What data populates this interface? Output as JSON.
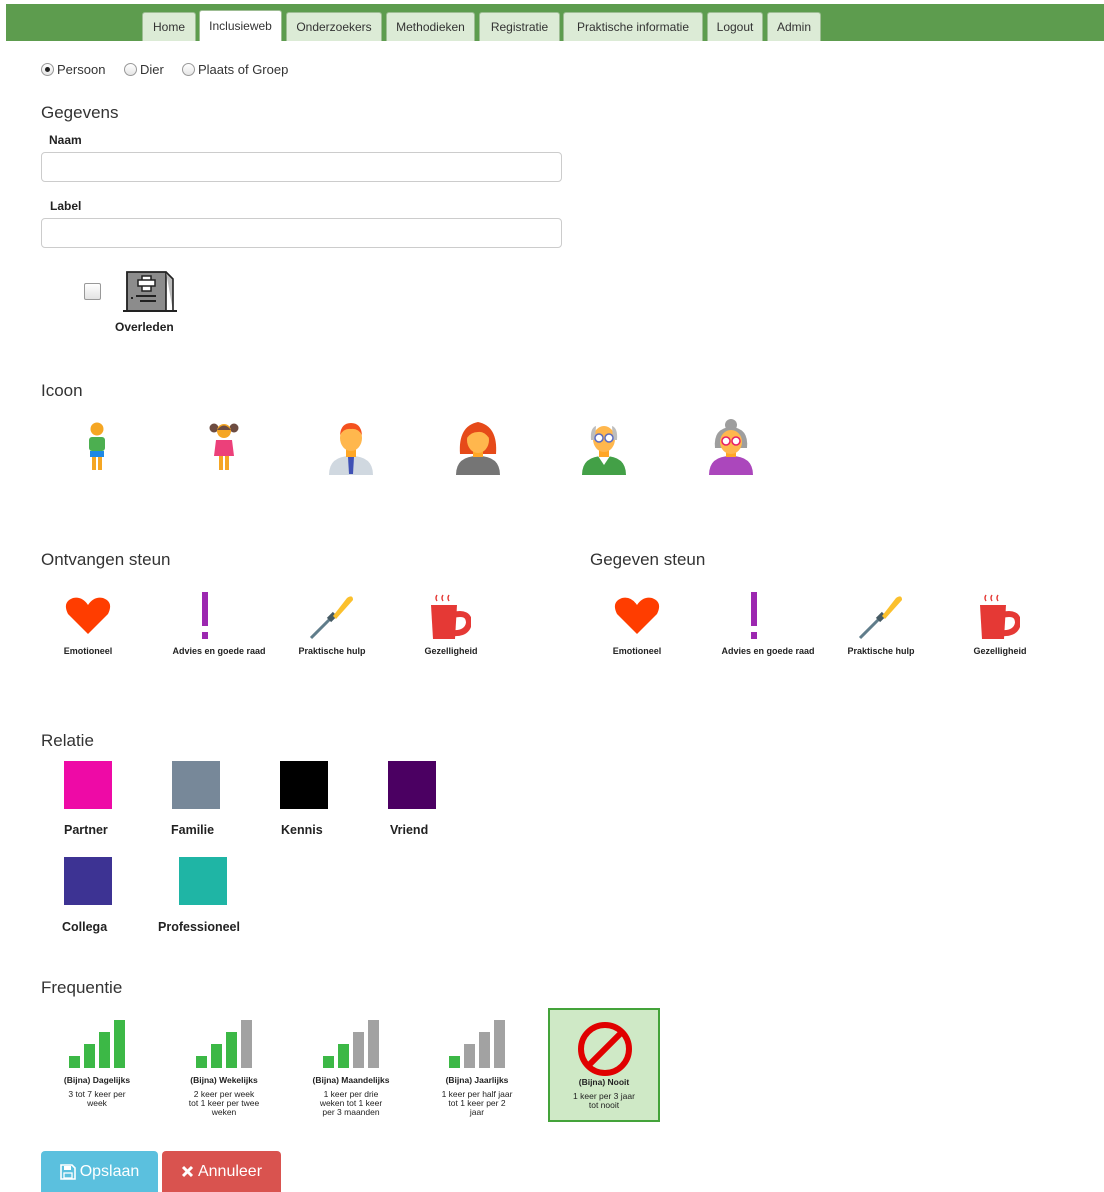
{
  "nav": {
    "tabs": [
      {
        "label": "Home",
        "active": false
      },
      {
        "label": "Inclusieweb",
        "active": true
      },
      {
        "label": "Onderzoekers",
        "active": false
      },
      {
        "label": "Methodieken",
        "active": false
      },
      {
        "label": "Registratie",
        "active": false
      },
      {
        "label": "Praktische informatie",
        "active": false
      },
      {
        "label": "Logout",
        "active": false
      },
      {
        "label": "Admin",
        "active": false
      }
    ]
  },
  "type_options": [
    {
      "label": "Persoon",
      "checked": true
    },
    {
      "label": "Dier",
      "checked": false
    },
    {
      "label": "Plaats of Groep",
      "checked": false
    }
  ],
  "gegevens": {
    "title": "Gegevens",
    "naam_label": "Naam",
    "naam_value": "",
    "label_label": "Label",
    "label_value": "",
    "overleden_label": "Overleden",
    "overleden_checked": false,
    "overleden_icon": "tombstone-icon"
  },
  "icoon": {
    "title": "Icoon",
    "icons": [
      "boy-icon",
      "girl-icon",
      "man-icon",
      "woman-icon",
      "old-man-icon",
      "old-woman-icon"
    ]
  },
  "ontvangen": {
    "title": "Ontvangen steun",
    "items": [
      {
        "label": "Emotioneel",
        "icon": "heart-icon"
      },
      {
        "label": "Advies en goede raad",
        "icon": "exclamation-icon"
      },
      {
        "label": "Praktische hulp",
        "icon": "screwdriver-icon"
      },
      {
        "label": "Gezelligheid",
        "icon": "mug-icon"
      }
    ]
  },
  "gegeven": {
    "title": "Gegeven steun",
    "items": [
      {
        "label": "Emotioneel",
        "icon": "heart-icon"
      },
      {
        "label": "Advies en goede raad",
        "icon": "exclamation-icon"
      },
      {
        "label": "Praktische hulp",
        "icon": "screwdriver-icon"
      },
      {
        "label": "Gezelligheid",
        "icon": "mug-icon"
      }
    ]
  },
  "relatie": {
    "title": "Relatie",
    "items": [
      {
        "label": "Partner",
        "color": "#ee0aa6"
      },
      {
        "label": "Familie",
        "color": "#778899"
      },
      {
        "label": "Kennis",
        "color": "#000000"
      },
      {
        "label": "Vriend",
        "color": "#4b0062"
      },
      {
        "label": "Collega",
        "color": "#3d3393"
      },
      {
        "label": "Professioneel",
        "color": "#1fb5a5"
      }
    ]
  },
  "frequentie": {
    "title": "Frequentie",
    "items": [
      {
        "title": "(Bijna) Dagelijks",
        "desc": "3 tot 7 keer per week",
        "green_bars": 4,
        "selected": false
      },
      {
        "title": "(Bijna) Wekelijks",
        "desc": "2 keer per week tot 1 keer per twee weken",
        "green_bars": 3,
        "selected": false
      },
      {
        "title": "(Bijna) Maandelijks",
        "desc": "1 keer per drie weken tot 1 keer per 3 maanden",
        "green_bars": 2,
        "selected": false
      },
      {
        "title": "(Bijna) Jaarlijks",
        "desc": "1 keer per half jaar tot 1 keer per 2 jaar",
        "green_bars": 1,
        "selected": false
      },
      {
        "title": "(Bijna) Nooit",
        "desc": "1 keer per 3 jaar tot nooit",
        "green_bars": 0,
        "selected": true,
        "icon": "prohibited-icon"
      }
    ]
  },
  "buttons": {
    "save_label": "Opslaan",
    "save_icon": "floppy-disk-icon",
    "cancel_label": "Annuleer",
    "cancel_icon": "close-icon"
  },
  "colors": {
    "nav_green": "#5d9c4e",
    "save_blue": "#5bc0de",
    "cancel_red": "#d9534f",
    "selected_bg": "#cfe9c6",
    "bar_green": "#3cb846",
    "bar_gray": "#a2a2a2"
  }
}
